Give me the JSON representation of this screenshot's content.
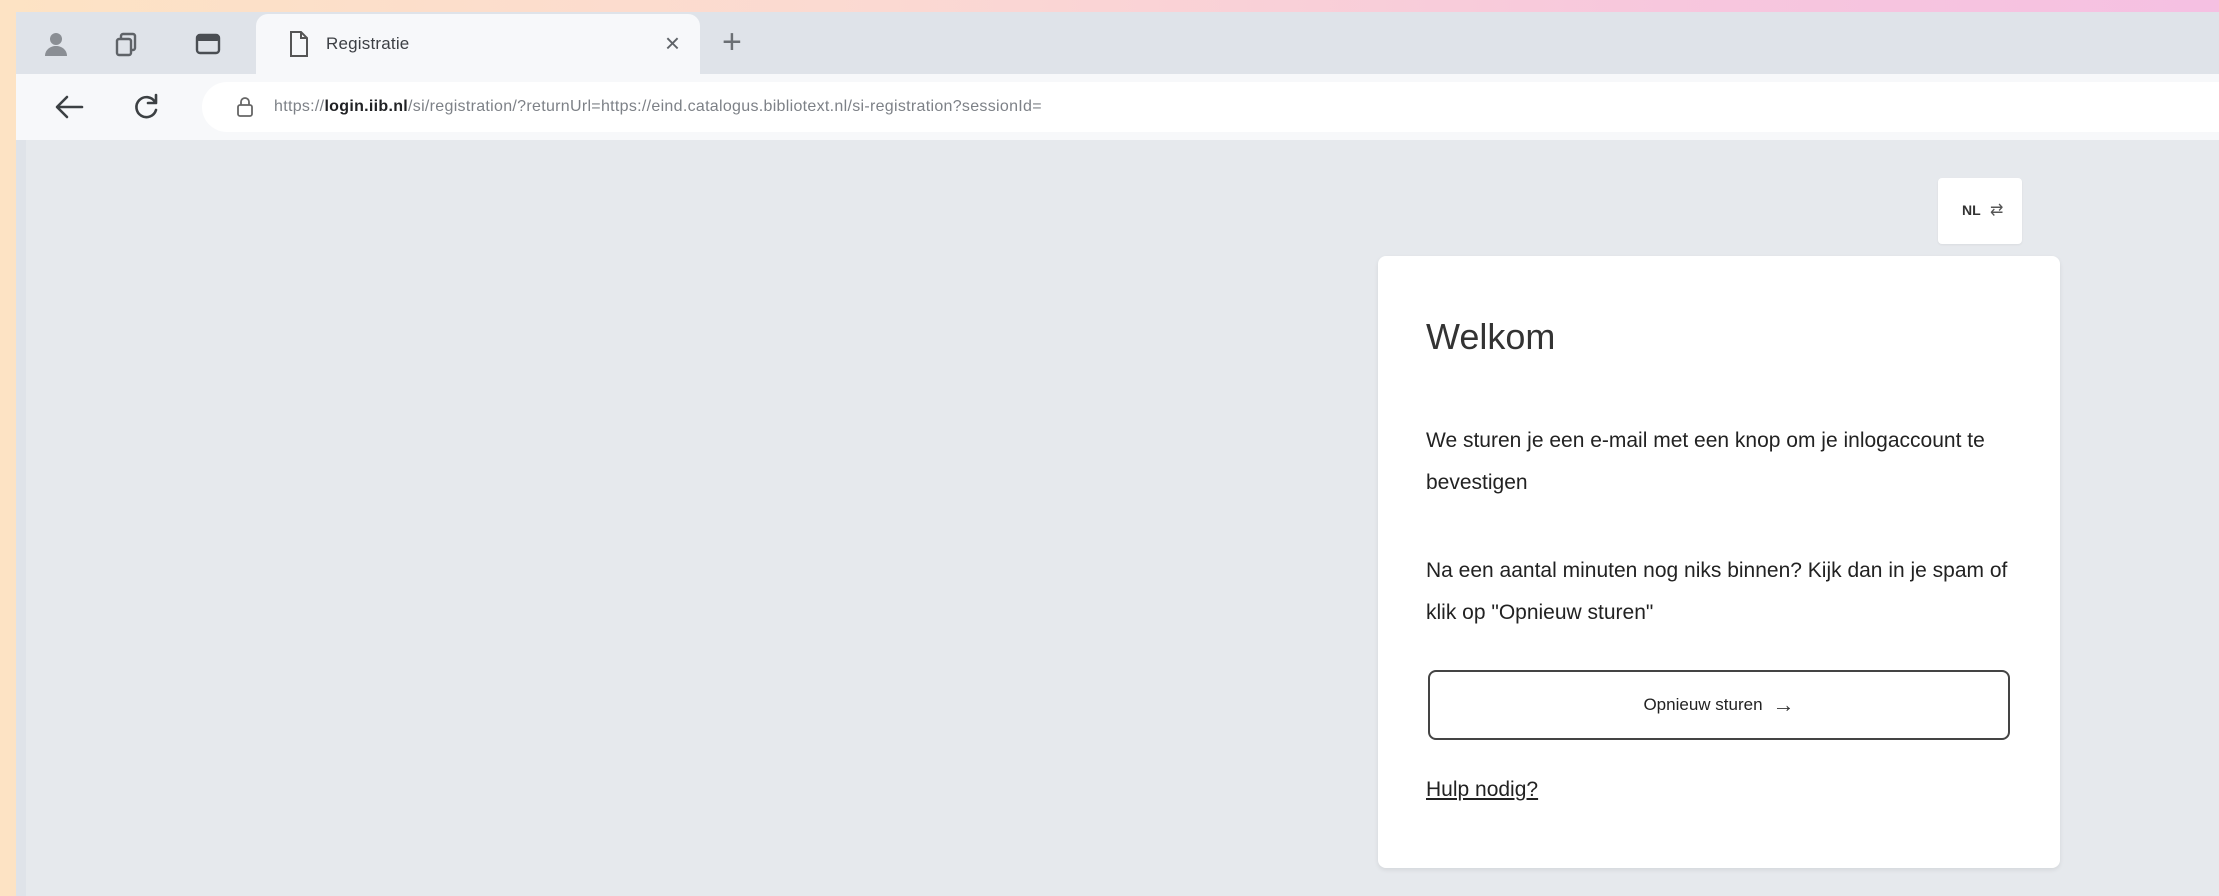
{
  "browser": {
    "tab_title": "Registratie",
    "tab_close": "×",
    "new_tab": "+",
    "url_prefix": "https://",
    "url_host": "login.iib.nl",
    "url_path": "/si/registration/?returnUrl=https://eind.catalogus.bibliotext.nl/si-registration?sessionId=",
    "icons": {
      "profile": "profile-icon",
      "workspaces": "workspaces-icon",
      "tab_actions": "tab-actions-icon",
      "back": "back-arrow-icon",
      "reload": "reload-icon",
      "site_info": "site-info-icon"
    }
  },
  "language": {
    "code": "NL",
    "swap_icon": "⇄"
  },
  "card": {
    "title": "Welkom",
    "text_1": "We sturen je een e-mail met een knop om je inlogaccount te bevestigen",
    "text_2": "Na een aantal minuten nog niks binnen? Kijk dan in je spam of klik op \"Opnieuw sturen\"",
    "resend_label": "Opnieuw sturen",
    "resend_arrow": "→",
    "help_link": "Hulp nodig?"
  },
  "colors": {
    "frame_bg": "#dfe3e9",
    "page_bg": "#e6e9ed",
    "card_bg": "#ffffff"
  }
}
